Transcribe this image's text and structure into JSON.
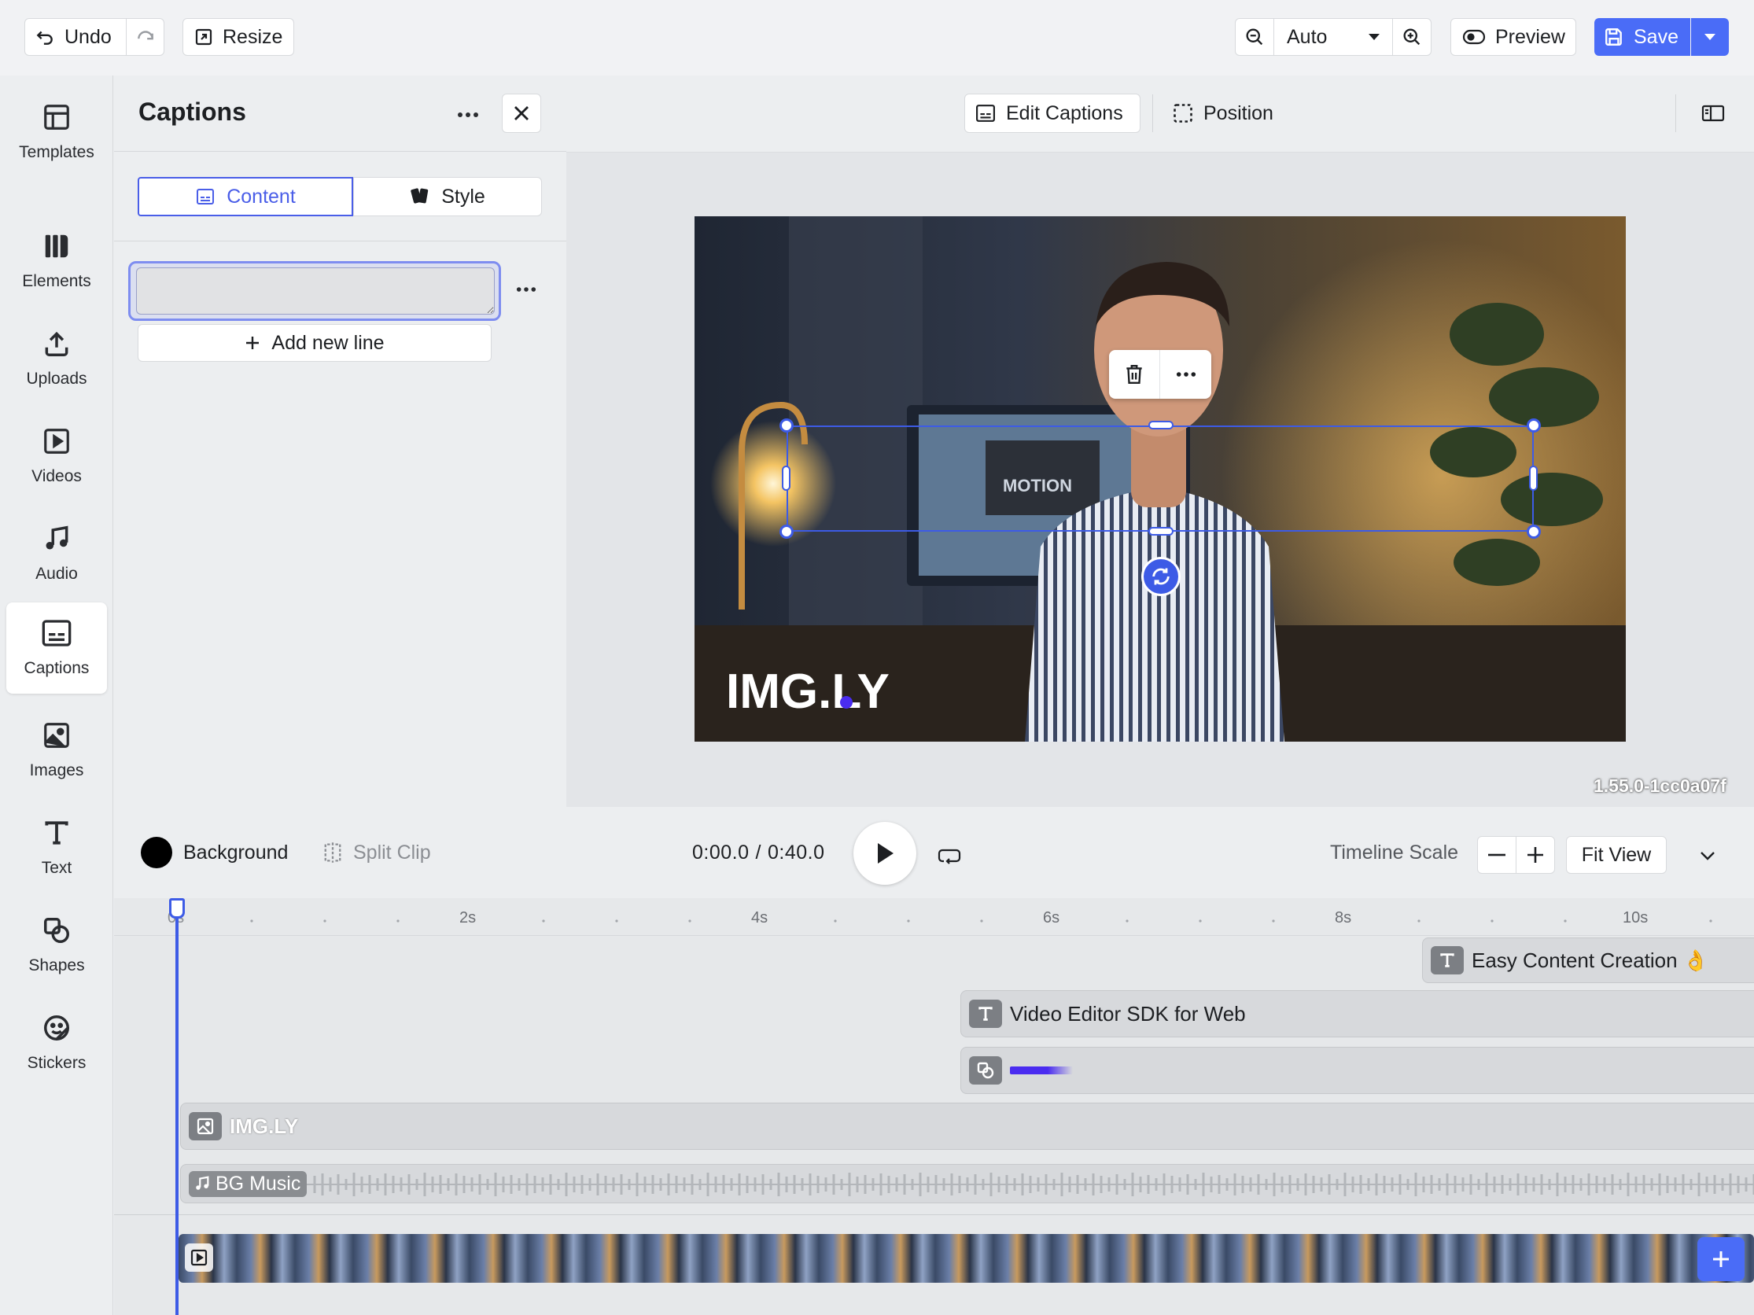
{
  "topbar": {
    "undo_label": "Undo",
    "resize_label": "Resize",
    "zoom_value": "Auto",
    "preview_label": "Preview",
    "save_label": "Save"
  },
  "rail": {
    "items": [
      {
        "label": "Templates",
        "icon": "templates-icon"
      },
      {
        "label": "Elements",
        "icon": "elements-icon"
      },
      {
        "label": "Uploads",
        "icon": "upload-icon"
      },
      {
        "label": "Videos",
        "icon": "video-icon"
      },
      {
        "label": "Audio",
        "icon": "music-icon"
      },
      {
        "label": "Captions",
        "icon": "captions-icon",
        "active": true
      },
      {
        "label": "Images",
        "icon": "image-icon"
      },
      {
        "label": "Text",
        "icon": "text-icon"
      },
      {
        "label": "Shapes",
        "icon": "shapes-icon"
      },
      {
        "label": "Stickers",
        "icon": "sticker-icon"
      }
    ]
  },
  "panel": {
    "title": "Captions",
    "tabs": [
      {
        "label": "Content",
        "active": true
      },
      {
        "label": "Style",
        "active": false
      }
    ],
    "caption_input_value": "",
    "add_line_label": "Add new line"
  },
  "canvas": {
    "edit_captions_label": "Edit Captions",
    "position_label": "Position",
    "video_overlay_text": "MOTION",
    "logo_text": "IMG.LY",
    "version": "1.55.0-1cc0a07f"
  },
  "timeline": {
    "background_label": "Background",
    "split_clip_label": "Split Clip",
    "time_current": "0:00.0",
    "time_total": "0:40.0",
    "time_separator": "/",
    "scale_label": "Timeline Scale",
    "fit_view_label": "Fit View",
    "ruler_ticks": [
      "0s",
      "2s",
      "4s",
      "6s",
      "8s",
      "10s"
    ],
    "clips": {
      "text1": "Easy Content Creation 👌",
      "text2": "Video Editor SDK for Web",
      "logo": "IMG.LY",
      "music": "BG Music"
    }
  },
  "colors": {
    "accent": "#4a5ee8",
    "save": "#4a6cf7",
    "canvas_bg": "#e3e5e8"
  }
}
